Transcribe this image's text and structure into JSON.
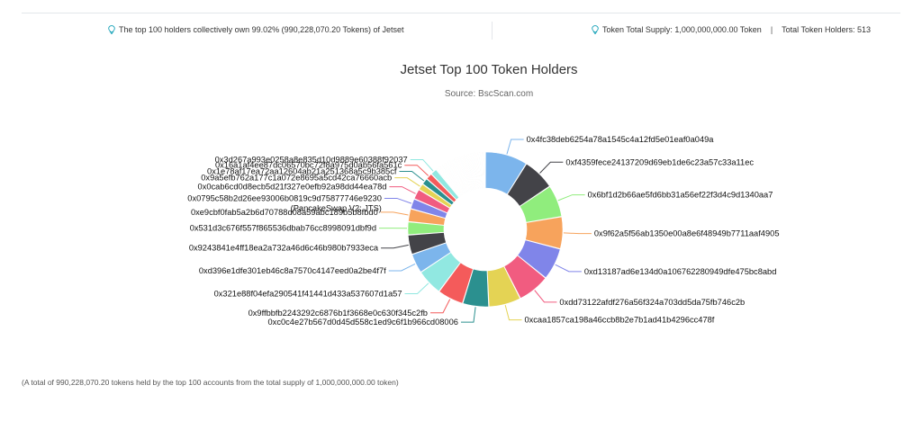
{
  "info_bar": {
    "left_text": "The top 100 holders collectively own 99.02% (990,228,070.20 Tokens) of Jetset",
    "supply_text": "Token Total Supply: 1,000,000,000.00 Token",
    "separator": "|",
    "holders_text": "Total Token Holders: 513",
    "icon": "lightbulb-icon",
    "icon_color": "#17a2b8"
  },
  "footnote": "(A total of 990,228,070.20 tokens held by the top 100 accounts from the total supply of 1,000,000,000.00 token)",
  "chart_data": {
    "type": "pie",
    "variant": "donut",
    "title": "Jetset Top 100 Token Holders",
    "subtitle": "Source: BscScan.com",
    "legend": "none",
    "labeled_slices": [
      {
        "label": "0x4fc38deb6254a78a1545c4a12fd5e01eaf0a049a",
        "value": 9.1,
        "color": "#7cb5ec"
      },
      {
        "label": "0xf4359fece24137209d69eb1de6c23a57c33a11ec",
        "value": 6.9,
        "color": "#434348"
      },
      {
        "label": "0x6bf1d2b66ae5fd6bb31a56ef22f3d4c9d1340aa7",
        "value": 6.9,
        "color": "#90ed7d"
      },
      {
        "label": "0x9f62a5f56ab1350e00a8e6f48949b7711aaf4905",
        "value": 6.9,
        "color": "#f7a35c"
      },
      {
        "label": "0xd13187ad6e134d0a106762280949dfe475bc8abd",
        "value": 6.9,
        "color": "#8085e9"
      },
      {
        "label": "0xdd73122afdf276a56f324a703dd5da75fb746c2b",
        "value": 6.9,
        "color": "#f15c80"
      },
      {
        "label": "0xcaa1857ca198a46ccb8b2e7b1ad41b4296cc478f",
        "value": 6.9,
        "color": "#e4d354"
      },
      {
        "label": "0xc0c4e27b567d0d45d558c1ed9c6f1b966cd08006",
        "value": 5.6,
        "color": "#2b908f"
      },
      {
        "label": "0x9ffbbfb2243292c6876b1f3668e0c630f345c2fb",
        "value": 5.6,
        "color": "#f45b5b"
      },
      {
        "label": "0x321e88f04efa290541f41441d433a537607d1a57",
        "value": 5.6,
        "color": "#91e8e1"
      },
      {
        "label": "0xd396e1dfe301eb46c8a7570c4147eed0a2be4f7f",
        "value": 4.2,
        "color": "#7cb5ec"
      },
      {
        "label": "0x9243841e4ff18ea2a732a46d6c46b980b7933eca",
        "value": 4.2,
        "color": "#434348"
      },
      {
        "label": "0x531d3c676f557f865536dbab76cc8998091dbf9d",
        "value": 2.8,
        "color": "#90ed7d"
      },
      {
        "label": "0xe9cbf0fab5a2b6d70788d08a59abc189b5b8fbd0",
        "value": 2.8,
        "color": "#f7a35c"
      },
      {
        "label": "0x0795c58b2d26ee93006b0819c9d75877746e9230",
        "label_line2": "(PancakeSwap V2: JTS)",
        "value": 2.2,
        "color": "#8085e9"
      },
      {
        "label": "0x0cab6cd0d8ecb5d21f327e0efb92a98dd44ea78d",
        "value": 2.2,
        "color": "#f15c80"
      },
      {
        "label": "0x9a5efb762a177c1a072e8695a5cd42ca76660acb",
        "value": 1.4,
        "color": "#e4d354"
      },
      {
        "label": "0x1e78af17ea72aa12604ab21a251368a5c9b385cf",
        "value": 1.4,
        "color": "#2b908f"
      },
      {
        "label": "0x16a1af4ee87dc06570bc72f8a975d0ab56fa561c",
        "value": 1.4,
        "color": "#f45b5b"
      },
      {
        "label": "0x3d267a993e0258a8e835d10d9889e60388f92037",
        "value": 1.4,
        "color": "#91e8e1"
      }
    ],
    "unlabeled_slices": {
      "count": 80,
      "value_each": 0.14,
      "colors": [
        "#7cb5ec",
        "#434348",
        "#90ed7d",
        "#f7a35c",
        "#8085e9",
        "#f15c80",
        "#e4d354",
        "#2b908f",
        "#f45b5b",
        "#91e8e1"
      ]
    }
  }
}
